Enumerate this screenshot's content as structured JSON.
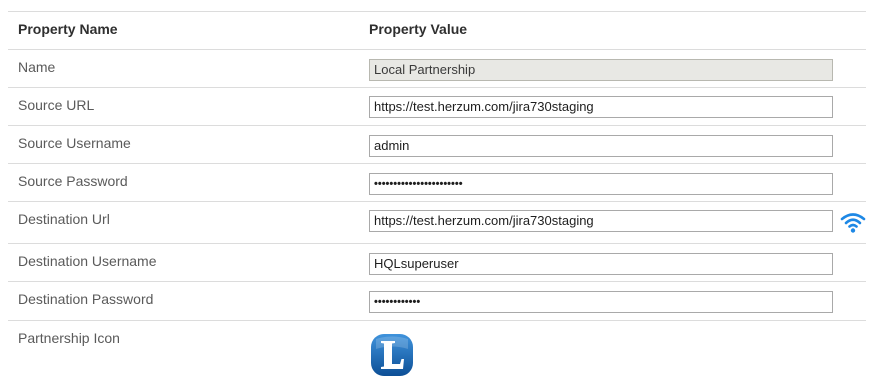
{
  "header": {
    "name_col": "Property Name",
    "value_col": "Property Value"
  },
  "rows": [
    {
      "label": "Name",
      "value": "Local Partnership",
      "kind": "readonly"
    },
    {
      "label": "Source URL",
      "value": "https://test.herzum.com/jira730staging",
      "kind": "text"
    },
    {
      "label": "Source Username",
      "value": "admin",
      "kind": "text"
    },
    {
      "label": "Source Password",
      "value": "•••••••••••••••••••••••",
      "kind": "password"
    },
    {
      "label": "Destination Url",
      "value": "https://test.herzum.com/jira730staging",
      "kind": "text"
    },
    {
      "label": "Destination Username",
      "value": "HQLsuperuser",
      "kind": "text"
    },
    {
      "label": "Destination Password",
      "value": "••••••••••••",
      "kind": "password"
    },
    {
      "label": "Partnership Icon",
      "kind": "icon"
    }
  ],
  "icons": {
    "connection_test": "wifi-icon",
    "partnership_logo": "partnership-logo-icon",
    "logo_color": "#1565b0"
  }
}
